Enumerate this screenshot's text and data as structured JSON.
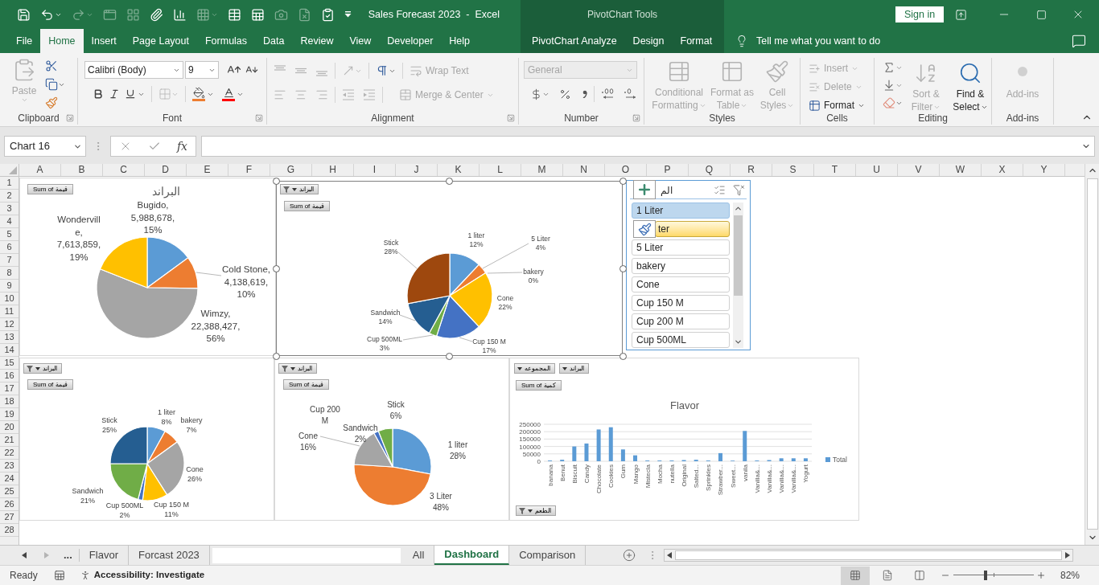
{
  "window": {
    "title": "Sales Forecast 2023  -  Excel",
    "context_title": "PivotChart Tools",
    "sign_in": "Sign in"
  },
  "quick_access": [
    {
      "kind": "save",
      "disabled": false
    },
    {
      "kind": "undo",
      "disabled": false
    },
    {
      "kind": "redo",
      "disabled": true
    },
    {
      "kind": "form",
      "disabled": true
    },
    {
      "kind": "grid",
      "disabled": true
    },
    {
      "kind": "attach",
      "disabled": false
    },
    {
      "kind": "chart",
      "disabled": false
    },
    {
      "kind": "pivot",
      "disabled": true
    },
    {
      "kind": "table",
      "disabled": false
    },
    {
      "kind": "sheet",
      "disabled": false
    },
    {
      "kind": "camera",
      "disabled": true
    },
    {
      "kind": "file_x",
      "disabled": true
    },
    {
      "kind": "checklist",
      "disabled": false
    },
    {
      "kind": "customize",
      "disabled": false
    }
  ],
  "ribbon_tabs": [
    {
      "label": "File",
      "kind": "standard",
      "selected": false
    },
    {
      "label": "Home",
      "kind": "standard",
      "selected": true
    },
    {
      "label": "Insert",
      "kind": "standard",
      "selected": false
    },
    {
      "label": "Page Layout",
      "kind": "standard",
      "selected": false
    },
    {
      "label": "Formulas",
      "kind": "standard",
      "selected": false
    },
    {
      "label": "Data",
      "kind": "standard",
      "selected": false
    },
    {
      "label": "Review",
      "kind": "standard",
      "selected": false
    },
    {
      "label": "View",
      "kind": "standard",
      "selected": false
    },
    {
      "label": "Developer",
      "kind": "standard",
      "selected": false
    },
    {
      "label": "Help",
      "kind": "standard",
      "selected": false
    },
    {
      "label": "PivotChart Analyze",
      "kind": "contextual",
      "selected": false
    },
    {
      "label": "Design",
      "kind": "contextual",
      "selected": false
    },
    {
      "label": "Format",
      "kind": "contextual",
      "selected": false
    }
  ],
  "tell_me": {
    "placeholder": "Tell me what you want to do"
  },
  "ribbon": {
    "clipboard": {
      "label": "Clipboard",
      "paste": {
        "label": "Paste",
        "disabled": true
      }
    },
    "font": {
      "label": "Font",
      "font_name": "Calibri (Body)",
      "font_size": "9",
      "borders_disabled": true
    },
    "alignment": {
      "label": "Alignment",
      "icons_disabled": true,
      "wrap_text": {
        "label": "Wrap Text",
        "disabled": true
      },
      "merge": {
        "label": "Merge & Center",
        "disabled": true
      }
    },
    "number": {
      "label": "Number",
      "format": {
        "value": "General",
        "disabled": true
      }
    },
    "styles": {
      "label": "Styles",
      "buttons": [
        {
          "kind": "conditional",
          "label": "Conditional Formatting",
          "disabled": true
        },
        {
          "kind": "table",
          "label": "Format as Table",
          "disabled": true
        },
        {
          "kind": "cell",
          "label": "Cell Styles",
          "disabled": true
        }
      ]
    },
    "cells": {
      "label": "Cells",
      "buttons": [
        {
          "kind": "insert",
          "label": "Insert",
          "disabled": true
        },
        {
          "kind": "delete",
          "label": "Delete",
          "disabled": true
        },
        {
          "kind": "format",
          "label": "Format",
          "disabled": false
        }
      ]
    },
    "editing": {
      "label": "Editing",
      "buttons": [
        {
          "kind": "sort",
          "label": "Sort & Filter",
          "disabled": true
        },
        {
          "kind": "find",
          "label": "Find & Select",
          "disabled": false
        }
      ]
    },
    "addins": {
      "label": "Add-ins",
      "button": {
        "label": "Add-ins",
        "disabled": true
      }
    }
  },
  "formula_bar": {
    "name_box": "Chart 16",
    "editing": false,
    "function_label": "fx"
  },
  "columns": [
    "A",
    "B",
    "C",
    "D",
    "E",
    "F",
    "G",
    "H",
    "I",
    "J",
    "K",
    "L",
    "M",
    "N",
    "O",
    "P",
    "Q",
    "R",
    "S",
    "T",
    "U",
    "V",
    "W",
    "X",
    "Y"
  ],
  "rows": [
    "1",
    "2",
    "3",
    "4",
    "5",
    "6",
    "7",
    "8",
    "9",
    "10",
    "11",
    "12",
    "13",
    "14",
    "15",
    "16",
    "17",
    "18",
    "19",
    "20",
    "21",
    "22",
    "23",
    "24",
    "25",
    "26",
    "27",
    "28"
  ],
  "charts": [
    {
      "selected": false,
      "field_buttons": [
        {
          "kind": "value",
          "label": "Sum of قيمة"
        }
      ],
      "chart_data": {
        "type": "pie",
        "title": "البراند",
        "categories": [
          "Bugido",
          "Cold Stone",
          "Wimzy",
          "Wonderville"
        ],
        "values": [
          5988678,
          4138619,
          22388427,
          7613859
        ],
        "value_labels": [
          ", 5,988,678, 15%",
          ", 4,138,619, 10%",
          ", 22,388,427, 56%",
          ", 7,613,859, 19%"
        ],
        "colors": [
          "#5b9bd5",
          "#ed7d31",
          "#a5a5a5",
          "#ffc000"
        ]
      }
    },
    {
      "selected": true,
      "field_buttons": [
        {
          "kind": "filter",
          "label": "البراند"
        },
        {
          "kind": "value",
          "label": "Sum of قيمة"
        }
      ],
      "chart_data": {
        "type": "pie",
        "categories": [
          "1 liter",
          "5 Liter",
          "bakery",
          "Cone",
          "Cup 150 M",
          "Cup 500ML",
          "Sandwich",
          "Stick"
        ],
        "values": [
          12,
          4,
          0,
          22,
          17,
          3,
          14,
          28
        ],
        "value_labels": [
          "12%",
          "4%",
          "0%",
          "22%",
          "17%",
          "3%",
          "14%",
          "28%"
        ],
        "colors": [
          "#5b9bd5",
          "#ed7d31",
          null,
          "#ffc000",
          "#4472c4",
          "#70ad47",
          "#255e91",
          "#9e480e"
        ]
      }
    },
    {
      "selected": false,
      "field_buttons": [
        {
          "kind": "filter",
          "label": "البراند"
        },
        {
          "kind": "value",
          "label": "Sum of قيمة"
        }
      ],
      "chart_data": {
        "type": "pie",
        "categories": [
          "1 liter",
          "bakery",
          "Cone",
          "Cup 150 M",
          "Cup 500ML",
          "Sandwich",
          "Stick"
        ],
        "values": [
          8,
          7,
          26,
          11,
          2,
          21,
          25
        ],
        "value_labels": [
          "8%",
          "7%",
          "26%",
          "11%",
          "2%",
          "21%",
          "25%"
        ],
        "colors": [
          "#5b9bd5",
          "#ed7d31",
          "#a5a5a5",
          "#ffc000",
          "#4472c4",
          "#70ad47",
          "#255e91"
        ]
      }
    },
    {
      "selected": false,
      "field_buttons": [
        {
          "kind": "filter",
          "label": "البراند"
        },
        {
          "kind": "value",
          "label": "Sum of قيمة"
        }
      ],
      "chart_data": {
        "type": "pie",
        "categories": [
          "1 liter",
          "3 Liter",
          "Cone",
          "Cup 200 M",
          "Sandwich",
          "Stick"
        ],
        "values": [
          28,
          48,
          16,
          null,
          2,
          6
        ],
        "value_labels": [
          "28%",
          "48%",
          "16%",
          null,
          "2%",
          "6%"
        ],
        "colors": [
          "#5b9bd5",
          "#ed7d31",
          "#a5a5a5",
          null,
          "#4472c4",
          "#70ad47"
        ]
      }
    },
    {
      "selected": false,
      "field_buttons": [
        {
          "kind": "dropdown",
          "label": "المجموعه"
        },
        {
          "kind": "dropdown",
          "label": "البراند"
        },
        {
          "kind": "value",
          "label": "Sum of كمية"
        },
        {
          "kind": "filter",
          "label": "الطعم"
        }
      ],
      "chart_data": {
        "type": "bar",
        "title": "Flavor",
        "categories": [
          "banana",
          "Benut",
          "Biscuit",
          "Candy",
          "Chocolate",
          "Cookies",
          "Gum",
          "Mango",
          "Mistecla",
          "Mocha",
          "nutella",
          "Original",
          "Salted...",
          "Sprinkles",
          "Strawber...",
          "Sweet...",
          "vanila",
          "Vanilla&...",
          "Vanilla&...",
          "Vanilla&...",
          "Vanilla&...",
          "Yogurt"
        ],
        "series": [
          {
            "name": "Total",
            "color": "#5b9bd5",
            "values": [
              5000,
              10000,
              100000,
              120000,
              215000,
              230000,
              80000,
              40000,
              5000,
              5000,
              5000,
              8000,
              10000,
              5000,
              55000,
              4000,
              205000,
              5000,
              8000,
              20000,
              20000,
              20000
            ]
          }
        ],
        "yticks": [
          0,
          50000,
          100000,
          150000,
          200000,
          250000
        ],
        "ylim": [
          0,
          250000
        ],
        "grid": true,
        "legend": "right"
      }
    }
  ],
  "slicer": {
    "title": "الم",
    "items": [
      {
        "label": "1 Liter",
        "selected": true,
        "hovered": false
      },
      {
        "label": "ter",
        "selected": false,
        "hovered": true
      },
      {
        "label": "5 Liter",
        "selected": false,
        "hovered": false
      },
      {
        "label": "bakery",
        "selected": false,
        "hovered": false
      },
      {
        "label": "Cone",
        "selected": false,
        "hovered": false
      },
      {
        "label": "Cup 150 M",
        "selected": false,
        "hovered": false
      },
      {
        "label": "Cup 200 M",
        "selected": false,
        "hovered": false
      },
      {
        "label": "Cup 500ML",
        "selected": false,
        "hovered": false
      }
    ]
  },
  "sheet_tabs": {
    "nav": [
      {
        "kind": "prev",
        "disabled": false
      },
      {
        "kind": "next",
        "disabled": true
      }
    ],
    "more": "...",
    "tabs": [
      {
        "kind": "tab",
        "label": "Flavor",
        "selected": false
      },
      {
        "kind": "tab",
        "label": "Forcast 2023",
        "selected": false
      },
      {
        "kind": "blank"
      },
      {
        "kind": "tab",
        "label": "All",
        "selected": false
      },
      {
        "kind": "tab",
        "label": "Dashboard",
        "selected": true
      },
      {
        "kind": "tab",
        "label": "Comparison",
        "selected": false
      }
    ]
  },
  "status_bar": {
    "mode": "Ready",
    "accessibility": "Accessibility: Investigate",
    "views": [
      {
        "kind": "normal",
        "selected": true
      },
      {
        "kind": "page_layout",
        "selected": false
      },
      {
        "kind": "page_break",
        "selected": false
      }
    ],
    "zoom": {
      "label": "82%",
      "level": 0.4
    }
  }
}
